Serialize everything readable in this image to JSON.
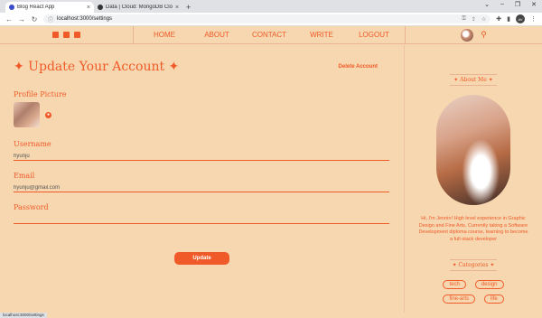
{
  "browser": {
    "tabs": [
      {
        "title": "Blog React App",
        "active": true
      },
      {
        "title": "Data | Cloud: MongoDB Cloud",
        "active": false
      }
    ],
    "url": "localhost:3000/settings"
  },
  "header": {
    "nav": [
      "HOME",
      "ABOUT",
      "CONTACT",
      "WRITE",
      "LOGOUT"
    ]
  },
  "settings": {
    "title": "✦ Update Your Account ✦",
    "delete_label": "Delete Account",
    "profile_picture_label": "Profile Picture",
    "username_label": "Username",
    "username_value": "hyunju",
    "email_label": "Email",
    "email_value": "hyunju@gmail.com",
    "password_label": "Password",
    "password_value": "",
    "update_label": "Update"
  },
  "sidebar": {
    "about_title": "✦ About Me ✦",
    "about_text": "Hi, I'm Jennin! High level experience in Graphic Design and Fine Arts. Currently taking a Software Development diploma course, learning to become a full-stack developer",
    "categories_title": "✦ Categories ✦",
    "categories": [
      "tech",
      "design",
      "fine-arts",
      "life"
    ]
  },
  "status_text": "localhost:3000/settings",
  "colors": {
    "accent": "#f05a28",
    "background": "#f6d7b0"
  }
}
